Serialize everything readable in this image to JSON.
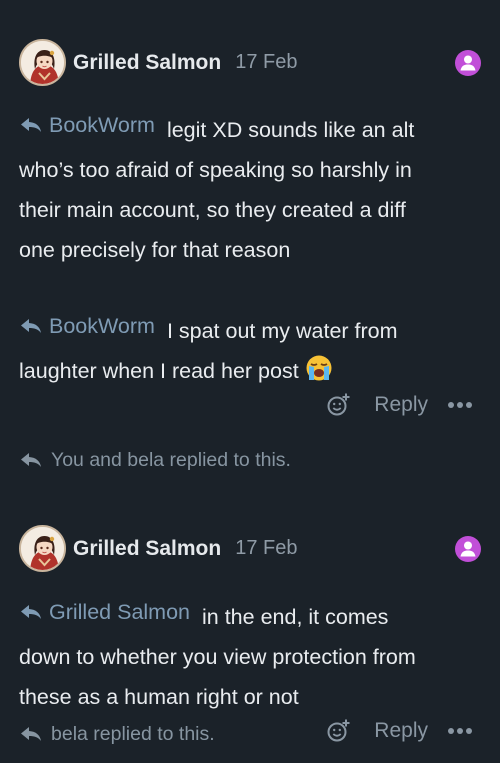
{
  "posts": [
    {
      "author": "Grilled Salmon",
      "date": "17 Feb",
      "quotes": [
        {
          "tag": "BookWorm",
          "text_first": "legit XD sounds like an alt",
          "text_rest": [
            "who’s too afraid of speaking so harshly in",
            "their main account, so they created a diff",
            "one precisely for that reason"
          ]
        },
        {
          "tag": "BookWorm",
          "text_first": "I spat out my water from",
          "text_rest": [
            "laughter when I read her post"
          ],
          "emoji": "loudly-crying-face-emoji"
        }
      ],
      "reply_label": "Reply",
      "replied_note": "You and bela replied to this."
    },
    {
      "author": "Grilled Salmon",
      "date": "17 Feb",
      "quotes": [
        {
          "tag": "Grilled Salmon",
          "text_first": "in the end, it comes",
          "text_rest": [
            "down to whether you view protection from",
            "these as a human right or not"
          ]
        }
      ],
      "reply_label": "Reply",
      "replied_note": "bela replied to this."
    }
  ],
  "colors": {
    "background": "#1b2229",
    "quote_tag": "#7f9bb4",
    "muted": "#8a97a3",
    "badge": "#c14fd8"
  },
  "icons": [
    "avatar",
    "user-badge-icon",
    "reply-arrow-icon",
    "add-reaction-icon",
    "more-options-icon"
  ]
}
